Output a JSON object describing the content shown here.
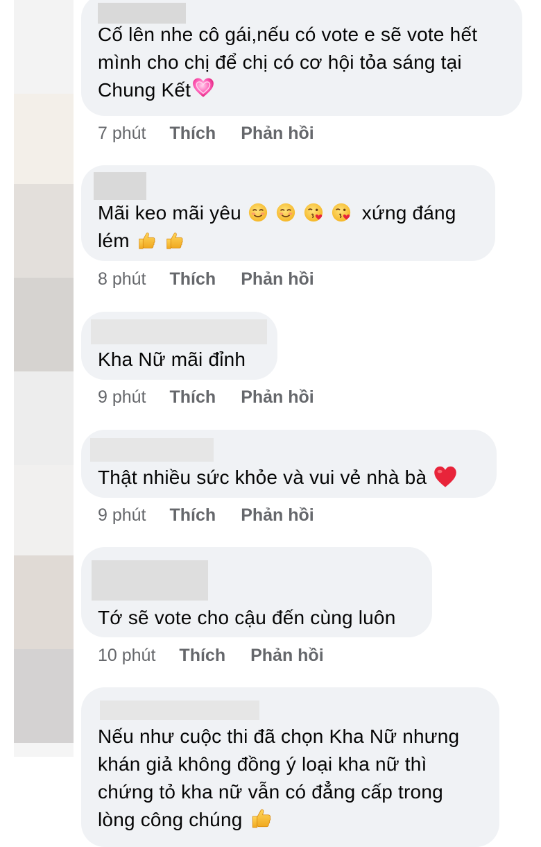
{
  "comments": [
    {
      "lines": [
        "Cố lên nhe cô gái,nếu có vote e sẽ vote hết",
        "mình cho chị để chị có cơ hội tỏa sáng tại",
        "Chung Kết"
      ],
      "time": "7 phút",
      "like": "Thích",
      "reply": "Phản hồi",
      "emojis": [
        "heart-pink-icon"
      ]
    },
    {
      "lines": [
        "Mãi keo mãi yêu",
        "xứng đáng",
        "lém"
      ],
      "time": "8 phút",
      "like": "Thích",
      "reply": "Phản hồi",
      "emojis": [
        "smiling-blush-icon",
        "smiling-blush-icon",
        "kissing-heart-icon",
        "kissing-heart-icon",
        "thumbs-up-icon",
        "thumbs-up-icon"
      ]
    },
    {
      "lines": [
        "Kha Nữ mãi đỉnh"
      ],
      "time": "9 phút",
      "like": "Thích",
      "reply": "Phản hồi",
      "emojis": []
    },
    {
      "lines": [
        "Thật nhiều sức khỏe và vui vẻ nhà bà"
      ],
      "time": "9 phút",
      "like": "Thích",
      "reply": "Phản hồi",
      "emojis": [
        "red-heart-icon"
      ]
    },
    {
      "lines": [
        "Tớ sẽ vote cho cậu đến cùng luôn"
      ],
      "time": "10 phút",
      "like": "Thích",
      "reply": "Phản hồi",
      "emojis": []
    },
    {
      "lines": [
        "Nếu như cuộc thi đã chọn Kha Nữ nhưng",
        "khán giả không đồng ý loại kha nữ thì",
        "chứng tỏ kha nữ vẫn có đẳng cấp trong",
        "lòng công chúng"
      ],
      "emojis": [
        "thumbs-up-icon"
      ]
    }
  ],
  "colors": {
    "bubble": "#f0f2f5",
    "meta_text": "#65676b",
    "text": "#050505",
    "name_mask": "#d9d9d9"
  }
}
